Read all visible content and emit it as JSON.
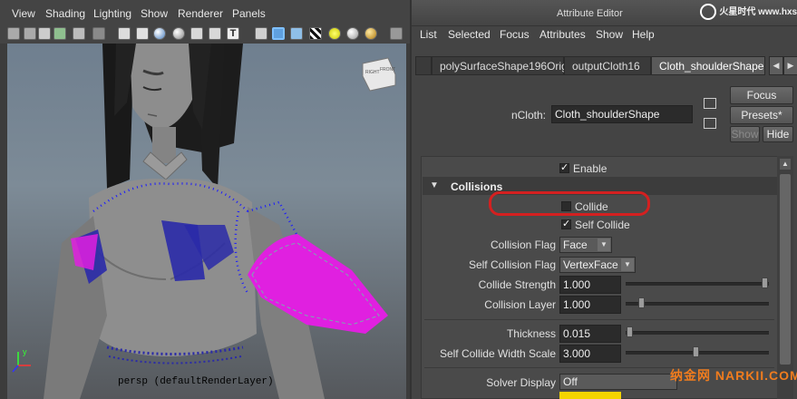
{
  "viewport": {
    "menu": [
      "View",
      "Shading",
      "Lighting",
      "Show",
      "Renderer",
      "Panels"
    ],
    "toolbar_icons": [
      "camera-icon",
      "camera-attr-icon",
      "bookmark-icon",
      "image-plane-icon",
      "grid-icon",
      "wireframe-icon",
      "smooth-shade-icon",
      "flat-shade-icon",
      "bounding-box-icon",
      "textured-icon",
      "text-icon",
      "cube-wire-icon",
      "cube-shaded-icon",
      "cube-textured-icon",
      "checker-icon",
      "light-icon",
      "sphere-white-icon",
      "sphere-shaded-icon",
      "isolate-icon"
    ],
    "panel_label": "persp (defaultRenderLayer)",
    "view_cube_labels": [
      "RIGHT",
      "FRONT"
    ]
  },
  "attribute_editor": {
    "title": "Attribute Editor",
    "menu": [
      "List",
      "Selected",
      "Focus",
      "Attributes",
      "Show",
      "Help"
    ],
    "tabs": [
      "polySurfaceShape196Orig",
      "outputCloth16",
      "Cloth_shoulderShape"
    ],
    "active_tab": "Cloth_shoulderShape",
    "node_type_label": "nCloth:",
    "node_name": "Cloth_shoulderShape",
    "buttons": {
      "focus": "Focus",
      "presets": "Presets*",
      "show": "Show",
      "hide": "Hide"
    },
    "enable_label": "Enable",
    "section_title": "Collisions",
    "collide_label": "Collide",
    "self_collide_label": "Self Collide",
    "collision_flag_label": "Collision Flag",
    "collision_flag_value": "Face",
    "self_collision_flag_label": "Self Collision Flag",
    "self_collision_flag_value": "VertexFace",
    "collide_strength_label": "Collide Strength",
    "collide_strength_value": "1.000",
    "collide_strength_level": 1.0,
    "collision_layer_label": "Collision Layer",
    "collision_layer_value": "1.000",
    "thickness_label": "Thickness",
    "thickness_value": "0.015",
    "self_collide_width_label": "Self Collide Width Scale",
    "self_collide_width_value": "3.000",
    "solver_display_label": "Solver Display",
    "solver_display_value": "Off"
  },
  "watermarks": {
    "top": "火星时代 www.hxsd.com",
    "bottom": "纳金网 NARKII.COM"
  },
  "colors": {
    "highlight_ring": "#d42020",
    "cloth_magenta": "#e020e0",
    "cloth_blue": "#2a2aa8",
    "solver_color_swatch": "#f5d400"
  }
}
